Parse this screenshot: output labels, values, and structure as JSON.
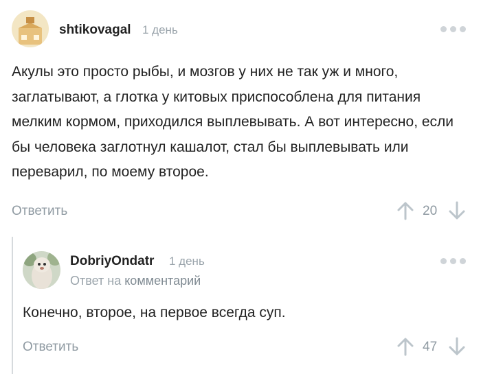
{
  "comments": [
    {
      "username": "shtikovagal",
      "time": "1 день",
      "avatar_icon": "box-character-avatar",
      "text": "Акулы это просто рыбы, и мозгов у них не так уж и много, заглатывают, а глотка у китовых приспособлена для питания мелким кормом, приходился выплевывать. А вот интересно, если бы человека заглотнул кашалот, стал бы выплевывать или переварил, по моему второе.",
      "reply_label": "Ответить",
      "score": "20"
    },
    {
      "username": "DobriyOndatr",
      "time": "1 день",
      "avatar_icon": "fluffy-creature-avatar",
      "reply_to_prefix": "Ответ на",
      "reply_to_link": "комментарий",
      "text": "Конечно, второе, на первое всегда суп.",
      "reply_label": "Ответить",
      "score": "47"
    }
  ],
  "colors": {
    "muted": "#8f9aa2",
    "vote_arrow": "#bcc5cb",
    "thread_line": "#d6dadd"
  }
}
